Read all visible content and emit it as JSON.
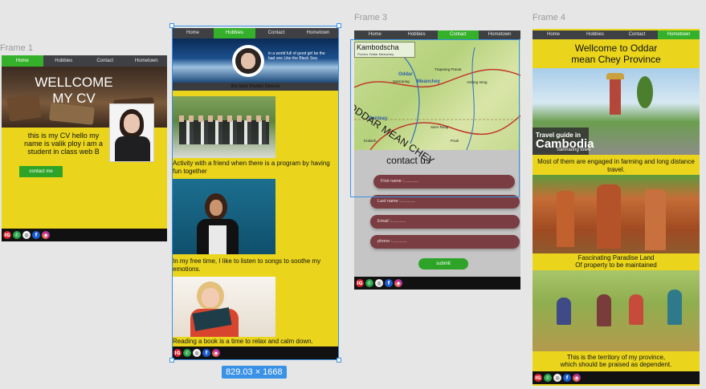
{
  "frames": {
    "f1": {
      "label": "Frame 1",
      "nav": [
        "Home",
        "Hobbies",
        "Contact",
        "Hometown"
      ],
      "hero_title_line1": "WELLCOME",
      "hero_title_line2": "MY CV",
      "intro": "this is my CV hello my name is valik ploy i am a student in class web B",
      "contact_button": "contact me"
    },
    "f2": {
      "label": "",
      "nav": [
        "Home",
        "Hobbies",
        "Contact",
        "Hometown"
      ],
      "banner_caption": "the best friends forever",
      "banner_quote": "in a world full of good girl be the bad one Like the Black Sea",
      "caption1": "Activity with a friend when there is a program by having fun together",
      "caption2": "In my free time, I like to listen to songs to soothe my emotions.",
      "caption3": "Reading a book is a time to relax and calm down."
    },
    "f3": {
      "label": "Frame 3",
      "nav": [
        "Home",
        "Hobbies",
        "Contact",
        "Hometown"
      ],
      "map_title": "Kambodscha",
      "map_subtitle": "Provinz Oddar Meanchey",
      "map_overlay": "ODDAR MEAN CHEY",
      "map_places": [
        "Oddar",
        "Meanchey",
        "Samraong",
        "Anlong Veng",
        "Trapeang Prasat",
        "Banteay",
        "Siem Reap",
        "Pouk",
        "Kralanh"
      ],
      "contact_heading": "contact us",
      "fields": [
        "First name :............",
        "Last name :............",
        "Email :............",
        "phone :............"
      ],
      "submit": "submit"
    },
    "f4": {
      "label": "Frame 4",
      "nav": [
        "Home",
        "Hobbies",
        "Contact",
        "Hometown"
      ],
      "title_line1": "Wellcome to Oddar",
      "title_line2": "mean Chey Province",
      "guide_big": "Cambodia",
      "guide_small": "Travel guide in",
      "guide_town": "Samraong town",
      "caption1": "Most of them are engaged in farming and long distance travel.",
      "caption2_line1": "Fascinating Paradise Land",
      "caption2_line2": "Of property to be maintained",
      "caption3_line1": "This is the territory of my province,",
      "caption3_line2": "which should be praised as dependent."
    }
  },
  "selection": {
    "size_label": "829.03 × 1668"
  },
  "social_icons": [
    "instagram-icon",
    "whatsapp-icon",
    "telegram-icon",
    "facebook-icon",
    "instagram-gradient-icon"
  ],
  "colors": {
    "frame_bg": "#ead51c",
    "nav_bg": "#3f4043",
    "active": "#35b02a",
    "selection": "#3a92e6"
  }
}
